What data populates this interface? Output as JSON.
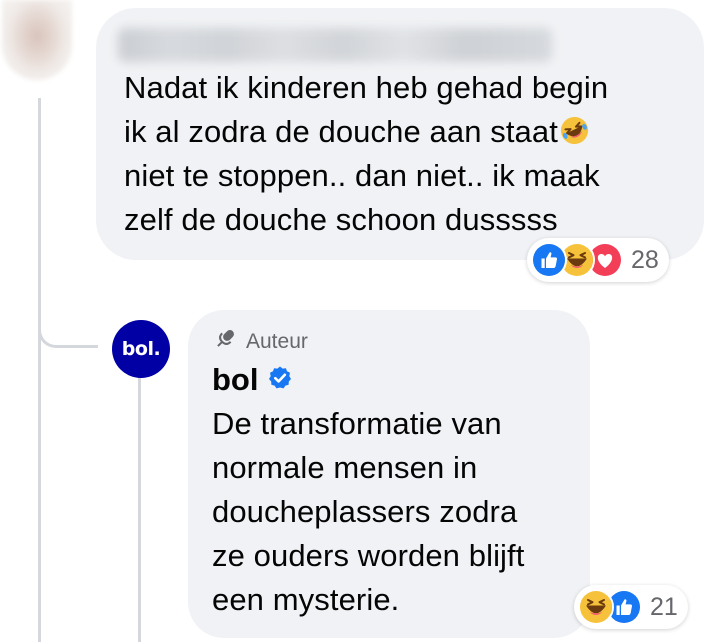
{
  "comment": {
    "text_lines": [
      "Nadat ik kinderen heb gehad begin",
      "ik al zodra de douche aan staat",
      "niet te stoppen.. dan niet.. ik maak",
      "zelf de douche schoon dusssss"
    ],
    "reactions": {
      "icons": [
        "like-icon",
        "laugh-emoji-icon",
        "love-icon"
      ],
      "count": "28"
    }
  },
  "reply": {
    "badge_label": "Auteur",
    "author_name": "bol",
    "avatar_text": "bol.",
    "text_lines": [
      "De transformatie van",
      "normale mensen in",
      "doucheplassers zodra",
      "ze ouders worden blijft",
      "een mysterie."
    ],
    "reactions": {
      "icons": [
        "laugh-emoji-icon",
        "like-icon"
      ],
      "count": "21"
    }
  },
  "colors": {
    "bubble": "#f0f2f5",
    "text": "#050505",
    "secondary_text": "#65676b",
    "like_blue": "#1877f2",
    "love_red": "#f33e58",
    "bol_blue": "#0000a4",
    "thread_line": "#d4d7dc"
  }
}
